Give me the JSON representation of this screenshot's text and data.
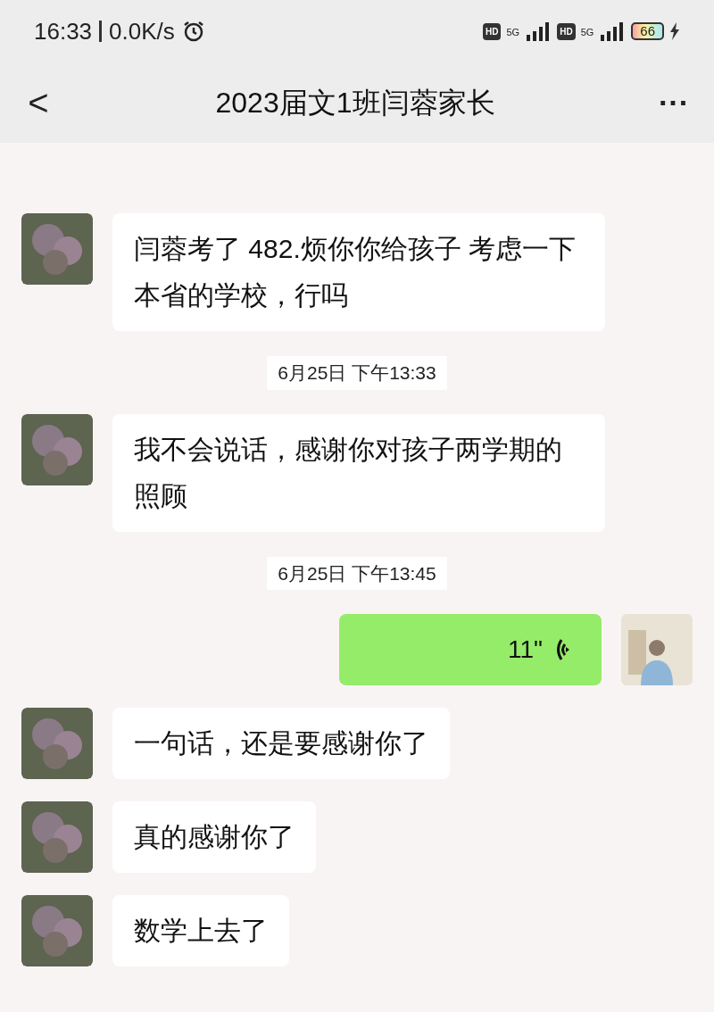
{
  "status_bar": {
    "time": "16:33",
    "speed": "0.0K/s",
    "network_1": "5G",
    "network_2": "5G",
    "hd_1": "HD",
    "hd_2": "HD",
    "battery": "66"
  },
  "header": {
    "back": "<",
    "title": "2023届文1班闫蓉家长",
    "more": "···"
  },
  "messages": [
    {
      "kind": "text",
      "outgoing": false,
      "text": "闫蓉考了 482.烦你你给孩子 考虑一下本省的学校，行吗"
    },
    {
      "kind": "time",
      "text": "6月25日 下午13:33"
    },
    {
      "kind": "text",
      "outgoing": false,
      "text": "我不会说话，感谢你对孩子两学期的照顾"
    },
    {
      "kind": "time",
      "text": "6月25日 下午13:45"
    },
    {
      "kind": "voice",
      "outgoing": true,
      "text": "11\""
    },
    {
      "kind": "text",
      "outgoing": false,
      "text": "一句话，还是要感谢你了"
    },
    {
      "kind": "text",
      "outgoing": false,
      "text": "真的感谢你了"
    },
    {
      "kind": "text",
      "outgoing": false,
      "text": "数学上去了"
    }
  ]
}
